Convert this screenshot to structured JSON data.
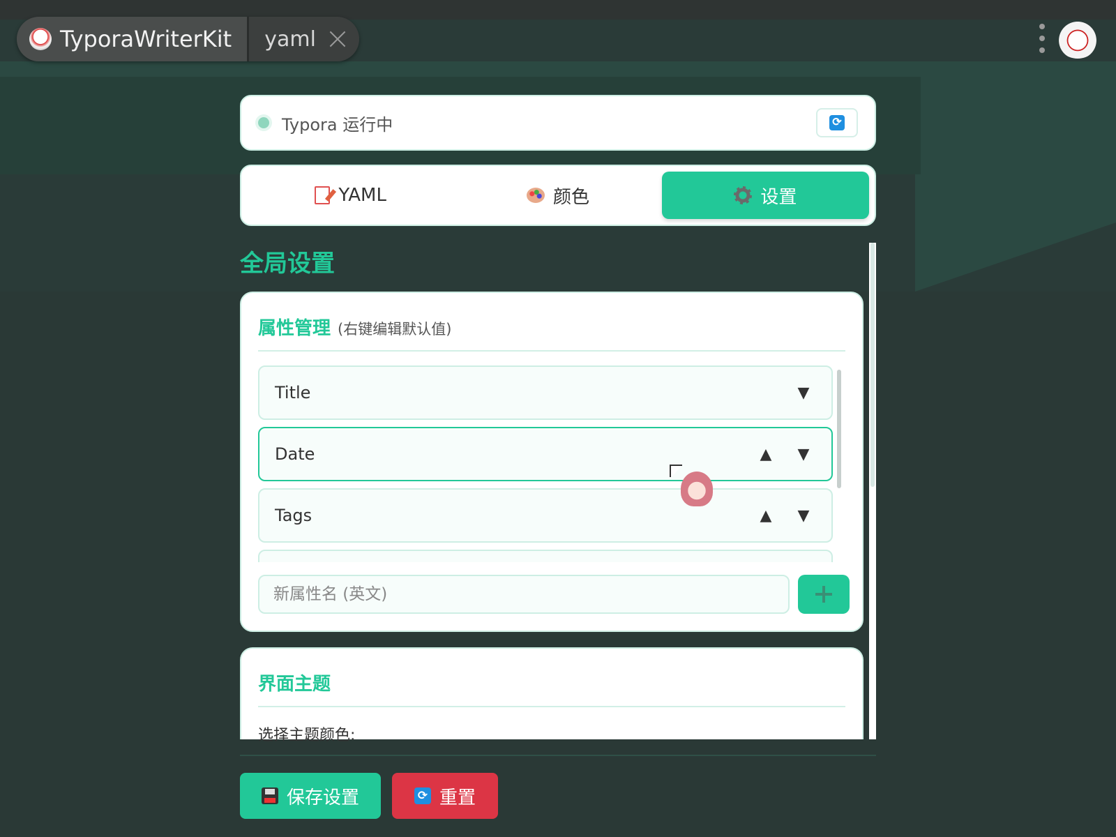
{
  "app": {
    "title": "TyporaWriterKit",
    "tab": "yaml"
  },
  "status": {
    "text": "Typora 运行中",
    "refresh_icon": "🔄"
  },
  "tabs": [
    {
      "label": "YAML",
      "icon": "pencil-memo-icon",
      "active": false
    },
    {
      "label": "颜色",
      "icon": "palette-icon",
      "active": false
    },
    {
      "label": "设置",
      "icon": "gear-icon",
      "active": true
    }
  ],
  "settings": {
    "title": "全局设置",
    "properties": {
      "title": "属性管理",
      "hint": "(右键编辑默认值)",
      "items": [
        {
          "name": "Title",
          "up": "",
          "down": "▼"
        },
        {
          "name": "Date",
          "up": "▲",
          "down": "▼"
        },
        {
          "name": "Tags",
          "up": "▲",
          "down": "▼"
        }
      ],
      "new_placeholder": "新属性名 (英文)",
      "new_value": ""
    },
    "theme": {
      "title": "界面主题",
      "label": "选择主题颜色:"
    }
  },
  "footer": {
    "save_label": "保存设置",
    "reset_label": "重置",
    "reset_icon": "🔄"
  },
  "colors": {
    "accent": "#22c898",
    "danger": "#dc3545",
    "border": "#cdeee4"
  }
}
